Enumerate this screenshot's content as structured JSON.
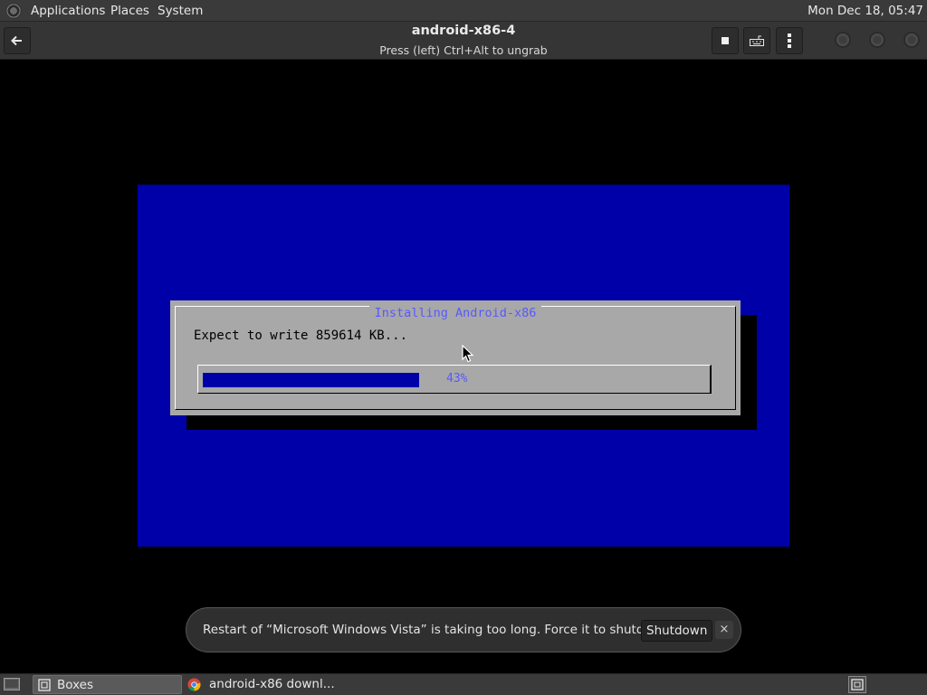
{
  "top_panel": {
    "menus": [
      "Applications",
      "Places",
      "System"
    ],
    "clock": "Mon Dec 18, 05:47"
  },
  "window": {
    "title": "android-x86-4",
    "subtitle": "Press (left) Ctrl+Alt to ungrab"
  },
  "installer": {
    "dialog_title": "Installing Android-x86",
    "message": "Expect to write 859614 KB...",
    "progress_fraction": 0.43,
    "progress_label": "43%"
  },
  "notification": {
    "message": "Restart of “Microsoft Windows Vista” is taking too long. Force it to shutdown?",
    "action_label": "Shutdown",
    "close_label": "×"
  },
  "taskbar": {
    "tasks": [
      {
        "label": "Boxes",
        "icon": "boxes-icon",
        "active": true
      },
      {
        "label": "android-x86 downl...",
        "icon": "chrome-icon",
        "active": false
      }
    ]
  },
  "colors": {
    "installer_bg": "#0000a8",
    "dialog_bg": "#a8a8a8",
    "accent_text": "#5858ff"
  }
}
